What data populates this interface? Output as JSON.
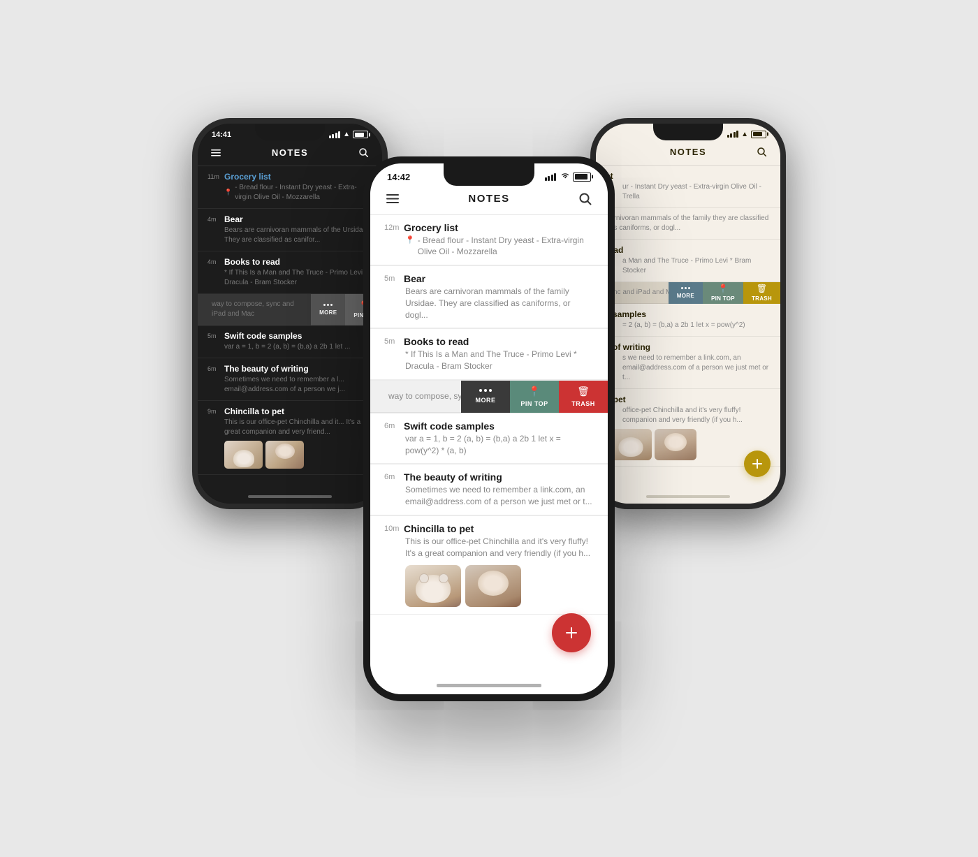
{
  "background": "#e8e8e8",
  "phones": {
    "left": {
      "theme": "dark",
      "time": "14:41",
      "title": "NOTES",
      "notes": [
        {
          "time": "11m",
          "title": "Grocery list",
          "preview": "- Bread flour - Instant Dry yeast - Extra-virgin Olive Oil - Mozzarella",
          "pin": true
        },
        {
          "time": "4m",
          "title": "Bear",
          "preview": "Bears are carnivoran mammals of the Ursidae. They are classified as canifor...",
          "pin": false
        },
        {
          "time": "4m",
          "title": "Books to read",
          "preview": "* If This Is a Man and The Truce - Primo Levi * Dracula - Bram Stocker",
          "pin": false
        },
        {
          "time": "",
          "title": "",
          "preview": "way to compose, sync and iPad and Mac",
          "pin": false,
          "swipe": true
        },
        {
          "time": "5m",
          "title": "Swift code samples",
          "preview": "var a = 1, b = 2 (a, b) = (b,a) a 2b 1 let x = ...",
          "pin": false
        },
        {
          "time": "6m",
          "title": "The beauty of writing",
          "preview": "Sometimes we need to remember a link.com, an email@address.com of a person we j...",
          "pin": false
        },
        {
          "time": "9m",
          "title": "Chincilla to pet",
          "preview": "This is our office-pet Chinchilla and it's very friendly (if you h...",
          "pin": false,
          "hasImages": true
        }
      ],
      "swipe_actions": [
        {
          "label": "MORE",
          "color": "#555"
        },
        {
          "label": "PIN TO",
          "color": "#666"
        }
      ]
    },
    "center": {
      "theme": "light",
      "time": "14:42",
      "title": "NOTES",
      "notes": [
        {
          "time": "12m",
          "title": "Grocery list",
          "preview": "- Bread flour - Instant Dry yeast - Extra-virgin Olive Oil - Mozzarella",
          "pin": true
        },
        {
          "time": "5m",
          "title": "Bear",
          "preview": "Bears are carnivoran mammals of the family Ursidae. They are classified as caniforms, or dogl...",
          "pin": false
        },
        {
          "time": "5m",
          "title": "Books to read",
          "preview": "* If This Is a Man and The Truce - Primo Levi * Dracula - Bram Stocker",
          "pin": false
        },
        {
          "time": "",
          "title": "",
          "preview": "way to compose, sync and iPad and Mac",
          "pin": false,
          "swipe": true,
          "context_actions": [
            {
              "label": "MORE",
              "color": "#3a3a3a"
            },
            {
              "label": "PIN TOP",
              "color": "#5a8a7a"
            },
            {
              "label": "TRASH",
              "color": "#cc3333"
            }
          ]
        },
        {
          "time": "6m",
          "title": "Swift code samples",
          "preview": "var a = 1, b = 2 (a, b) = (b,a) a 2b 1 let x = pow(y^2) * (a, b)",
          "pin": false
        },
        {
          "time": "6m",
          "title": "The beauty of writing",
          "preview": "Sometimes we need to remember a link.com, an email@address.com of a person we just met or t...",
          "pin": false
        },
        {
          "time": "10m",
          "title": "Chincilla to pet",
          "preview": "This is our office-pet Chinchilla and it's very fluffy! It's a great companion and very friendly (if you h...",
          "pin": false,
          "hasImages": true
        }
      ]
    },
    "right": {
      "theme": "warm",
      "time": "",
      "title": "NOTES",
      "notes": [
        {
          "time": "",
          "title": "st",
          "preview": "ur - Instant Dry yeast - Extra-virgin Olive Oil - Trella",
          "pin": false
        },
        {
          "time": "",
          "title": "",
          "preview": "arnivoran mammals of the family they are classified as caniforms, or dogl...",
          "pin": false
        },
        {
          "time": "",
          "title": "read",
          "preview": "a Man and The Truce - Primo Levi * Bram Stocker",
          "pin": false
        },
        {
          "time": "",
          "title": "",
          "preview": "ync and iPad and Mac",
          "pin": false,
          "swipe": true,
          "context_actions": [
            {
              "label": "MORE",
              "color": "#5a7a8a"
            },
            {
              "label": "PIN TOP",
              "color": "#6a8a7a"
            },
            {
              "label": "TRASH",
              "color": "#b8960c"
            }
          ]
        },
        {
          "time": "",
          "title": "e samples",
          "preview": "= 2 (a, b) = (b,a) a 2b 1 let x = pow(y^2)",
          "pin": false
        },
        {
          "time": "",
          "title": "y of writing",
          "preview": "s we need to remember a link.com, an email@address.com of a person we just met or t...",
          "pin": false
        },
        {
          "time": "",
          "title": "o pet",
          "preview": "office-pet Chinchilla and it's very fluffy! companion and very friendly (if you h...",
          "pin": false,
          "hasImages": true
        }
      ]
    }
  },
  "icons": {
    "menu": "☰",
    "search": "⌕",
    "more_dots": "•••",
    "pin": "📍",
    "trash": "🗑",
    "add": "+",
    "signal": "▪▪▪▪",
    "wifi": "wifi",
    "battery": "battery"
  },
  "labels": {
    "more": "MORE",
    "pin_top": "PIN TOP",
    "trash": "TRASH"
  }
}
